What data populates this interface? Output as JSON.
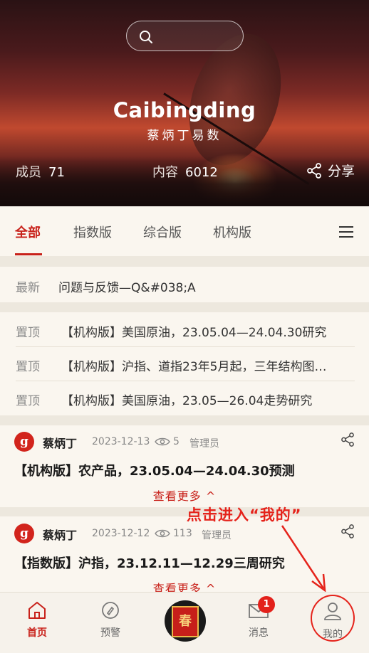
{
  "hero": {
    "brand_en": "Caibingding",
    "brand_cn": "蔡炳丁易数",
    "members_label": "成员",
    "members_value": "71",
    "content_label": "内容",
    "content_value": "6012",
    "share_label": "分享"
  },
  "tabs": [
    {
      "label": "全部",
      "active": true
    },
    {
      "label": "指数版"
    },
    {
      "label": "综合版"
    },
    {
      "label": "机构版"
    }
  ],
  "latest": {
    "label": "最新",
    "text": "问题与反馈—Q&#038;A"
  },
  "pinned": [
    {
      "label": "置顶",
      "text": "【机构版】美国原油，23.05.04—24.04.30研究"
    },
    {
      "label": "置顶",
      "text": "【机构版】沪指、道指23年5月起，三年结构图…"
    },
    {
      "label": "置顶",
      "text": "【机构版】美国原油，23.05—26.04走势研究"
    }
  ],
  "posts": [
    {
      "avatar": "g",
      "author": "蔡炳丁",
      "date": "2023-12-13",
      "views": "5",
      "role": "管理员",
      "title": "【机构版】农产品，23.05.04—24.04.30预测",
      "more": "查看更多 ^"
    },
    {
      "avatar": "g",
      "author": "蔡炳丁",
      "date": "2023-12-12",
      "views": "113",
      "role": "管理员",
      "title": "【指数版】沪指，23.12.11—12.29三周研究",
      "more": "查看更多 ^"
    }
  ],
  "annotation": "点击进入“我的”",
  "bottomnav": {
    "home": "首页",
    "alert": "预警",
    "center_char": "春",
    "messages": "消息",
    "messages_badge": "1",
    "mine": "我的"
  },
  "colors": {
    "accent": "#c8211a",
    "background": "#f4f0e8"
  },
  "icons": [
    "search-icon",
    "share-icon",
    "menu-icon",
    "eye-icon",
    "home-icon",
    "compass-icon",
    "mail-icon",
    "user-icon"
  ]
}
